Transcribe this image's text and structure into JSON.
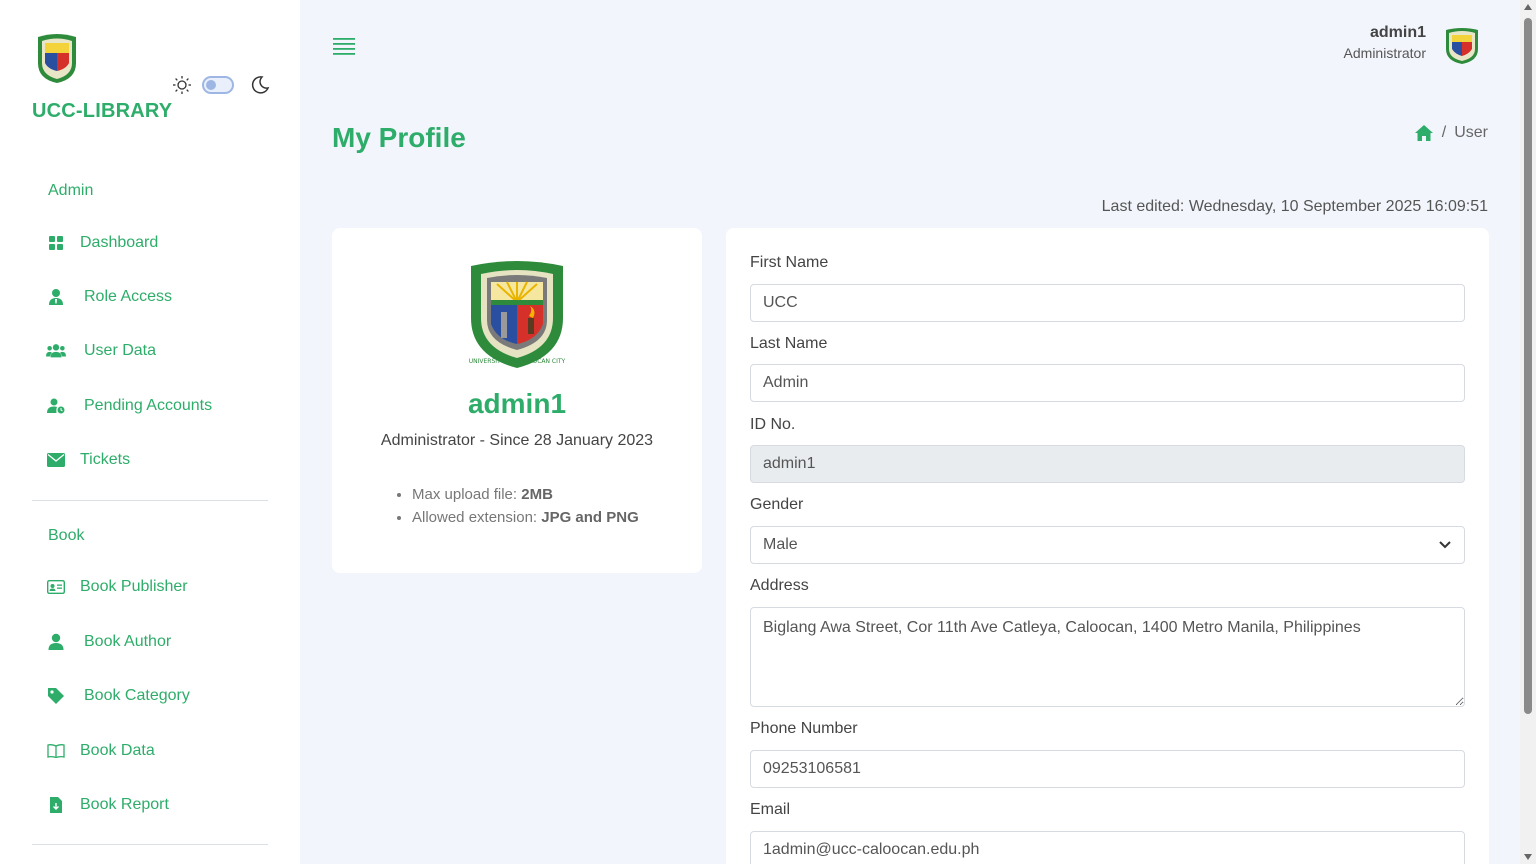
{
  "sidebar": {
    "brand": "UCC-LIBRARY",
    "sections": [
      {
        "title": "Admin",
        "items": [
          {
            "label": "Dashboard",
            "icon": "grid-icon"
          },
          {
            "label": "Role Access",
            "icon": "user-tie-icon"
          },
          {
            "label": "User Data",
            "icon": "users-icon"
          },
          {
            "label": "Pending Accounts",
            "icon": "user-clock-icon"
          },
          {
            "label": "Tickets",
            "icon": "envelope-icon"
          }
        ]
      },
      {
        "title": "Book",
        "items": [
          {
            "label": "Book Publisher",
            "icon": "id-card-icon"
          },
          {
            "label": "Book Author",
            "icon": "user-icon"
          },
          {
            "label": "Book Category",
            "icon": "tag-icon"
          },
          {
            "label": "Book Data",
            "icon": "book-open-icon"
          },
          {
            "label": "Book Report",
            "icon": "file-download-icon"
          }
        ]
      }
    ]
  },
  "topbar": {
    "username": "admin1",
    "role": "Administrator"
  },
  "page": {
    "title": "My Profile",
    "breadcrumb": {
      "separator": "/",
      "current": "User"
    },
    "last_edited": "Last edited: Wednesday, 10 September 2025 16:09:51"
  },
  "profile": {
    "name": "admin1",
    "subtitle": "Administrator - Since 28 January 2023",
    "notes": [
      {
        "label": "Max upload file: ",
        "value": "2MB"
      },
      {
        "label": "Allowed extension: ",
        "value": "JPG and PNG"
      }
    ]
  },
  "form": {
    "first_name": {
      "label": "First Name",
      "value": "UCC"
    },
    "last_name": {
      "label": "Last Name",
      "value": "Admin"
    },
    "id_no": {
      "label": "ID No.",
      "value": "admin1"
    },
    "gender": {
      "label": "Gender",
      "value": "Male"
    },
    "address": {
      "label": "Address",
      "value": "Biglang Awa Street, Cor 11th Ave Catleya, Caloocan, 1400 Metro Manila, Philippines"
    },
    "phone": {
      "label": "Phone Number",
      "value": "09253106581"
    },
    "email": {
      "label": "Email",
      "value": "1admin@ucc-caloocan.edu.ph"
    }
  },
  "colors": {
    "accent": "#2ead6a",
    "background": "#f2f6fc",
    "card": "#ffffff"
  }
}
